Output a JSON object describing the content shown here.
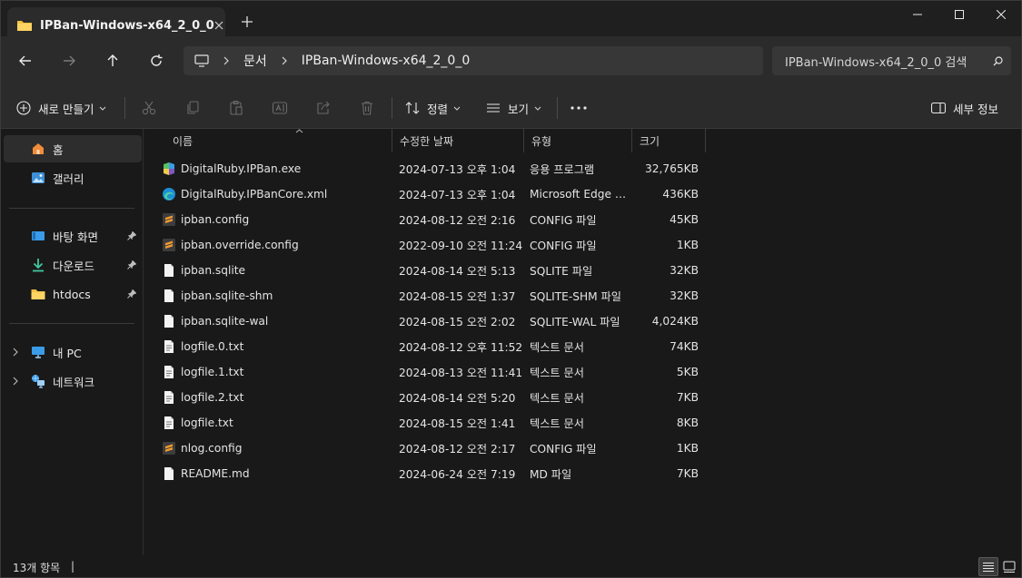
{
  "window": {
    "tab_title": "IPBan-Windows-x64_2_0_0",
    "tab_close_icon": "close-icon",
    "new_tab_icon": "plus-icon"
  },
  "navigation": {
    "back_icon": "arrow-left-icon",
    "forward_icon": "arrow-right-icon",
    "up_icon": "arrow-up-icon",
    "refresh_icon": "refresh-icon",
    "breadcrumbs": [
      "문서",
      "IPBan-Windows-x64_2_0_0"
    ],
    "search_placeholder": "IPBan-Windows-x64_2_0_0 검색"
  },
  "toolbar": {
    "new_label": "새로 만들기",
    "sort_label": "정렬",
    "view_label": "보기",
    "details_label": "세부 정보"
  },
  "sidebar": {
    "items": [
      {
        "label": "홈",
        "icon": "home-icon",
        "selected": true
      },
      {
        "label": "갤러리",
        "icon": "gallery-icon"
      },
      {
        "label": "바탕 화면",
        "icon": "desktop-icon",
        "pinned": true
      },
      {
        "label": "다운로드",
        "icon": "download-icon",
        "pinned": true
      },
      {
        "label": "htdocs",
        "icon": "folder-icon",
        "pinned": true
      },
      {
        "label": "내 PC",
        "icon": "pc-icon",
        "expandable": true
      },
      {
        "label": "네트워크",
        "icon": "network-icon",
        "expandable": true
      }
    ]
  },
  "columns": {
    "name": "이름",
    "date": "수정한 날짜",
    "type": "유형",
    "size": "크기"
  },
  "files": [
    {
      "name": "DigitalRuby.IPBan.exe",
      "date": "2024-07-13 오후 1:04",
      "type": "응용 프로그램",
      "size": "32,765KB",
      "icon": "app-icon"
    },
    {
      "name": "DigitalRuby.IPBanCore.xml",
      "date": "2024-07-13 오후 1:04",
      "type": "Microsoft Edge H...",
      "size": "436KB",
      "icon": "edge-icon"
    },
    {
      "name": "ipban.config",
      "date": "2024-08-12 오전 2:16",
      "type": "CONFIG 파일",
      "size": "45KB",
      "icon": "sublime-file-icon"
    },
    {
      "name": "ipban.override.config",
      "date": "2022-09-10 오전 11:24",
      "type": "CONFIG 파일",
      "size": "1KB",
      "icon": "sublime-file-icon"
    },
    {
      "name": "ipban.sqlite",
      "date": "2024-08-14 오전 5:13",
      "type": "SQLITE 파일",
      "size": "32KB",
      "icon": "blank-file-icon"
    },
    {
      "name": "ipban.sqlite-shm",
      "date": "2024-08-15 오전 1:37",
      "type": "SQLITE-SHM 파일",
      "size": "32KB",
      "icon": "blank-file-icon"
    },
    {
      "name": "ipban.sqlite-wal",
      "date": "2024-08-15 오전 2:02",
      "type": "SQLITE-WAL 파일",
      "size": "4,024KB",
      "icon": "blank-file-icon"
    },
    {
      "name": "logfile.0.txt",
      "date": "2024-08-12 오후 11:52",
      "type": "텍스트 문서",
      "size": "74KB",
      "icon": "text-file-icon"
    },
    {
      "name": "logfile.1.txt",
      "date": "2024-08-13 오전 11:41",
      "type": "텍스트 문서",
      "size": "5KB",
      "icon": "text-file-icon"
    },
    {
      "name": "logfile.2.txt",
      "date": "2024-08-14 오전 5:20",
      "type": "텍스트 문서",
      "size": "7KB",
      "icon": "text-file-icon"
    },
    {
      "name": "logfile.txt",
      "date": "2024-08-15 오전 1:41",
      "type": "텍스트 문서",
      "size": "8KB",
      "icon": "text-file-icon"
    },
    {
      "name": "nlog.config",
      "date": "2024-08-12 오전 2:17",
      "type": "CONFIG 파일",
      "size": "1KB",
      "icon": "sublime-file-icon"
    },
    {
      "name": "README.md",
      "date": "2024-06-24 오전 7:19",
      "type": "MD 파일",
      "size": "7KB",
      "icon": "blank-file-icon"
    }
  ],
  "status": {
    "item_count": "13개 항목",
    "separator": "|"
  },
  "colors": {
    "background": "#191919",
    "toolbar": "#2b2b2b",
    "folder_yellow": "#f5c042",
    "accent_blue": "#4aa3f0",
    "sublime_orange": "#f29b2e"
  }
}
